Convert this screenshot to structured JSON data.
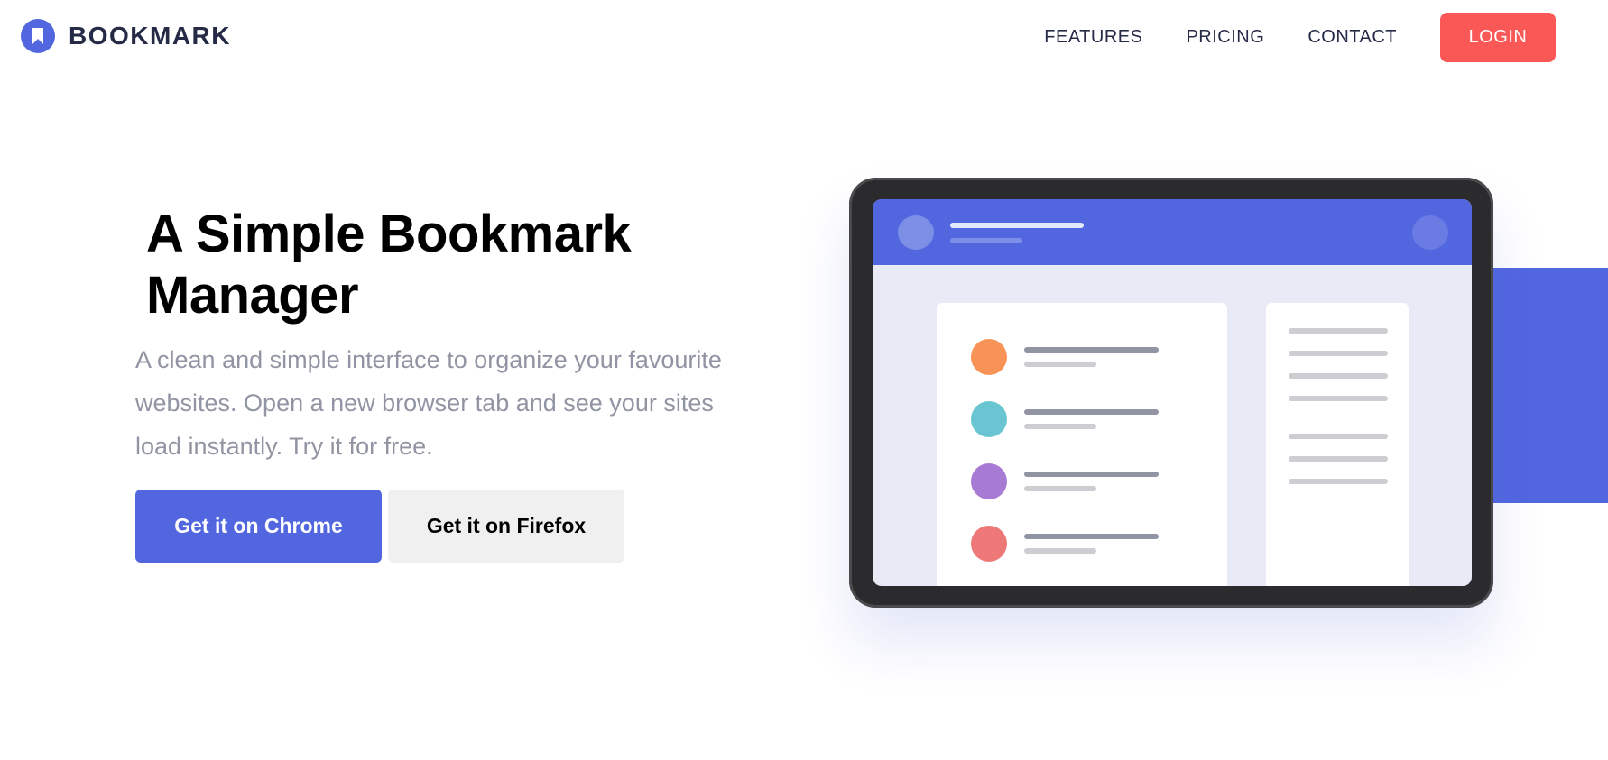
{
  "brand": {
    "name": "BOOKMARK",
    "icon": "bookmark-icon",
    "color": "#5267df"
  },
  "nav": {
    "links": [
      {
        "label": "FEATURES"
      },
      {
        "label": "PRICING"
      },
      {
        "label": "CONTACT"
      }
    ],
    "login_label": "LOGIN"
  },
  "hero": {
    "title": "A Simple Bookmark Manager",
    "description": "A clean and simple interface to organize your favourite websites. Open a new browser tab and see your sites load instantly. Try it for free.",
    "chrome_button": "Get it on Chrome",
    "firefox_button": "Get it on Firefox"
  },
  "colors": {
    "primary": "#5267df",
    "accent": "#fa5757",
    "dark": "#252b46",
    "muted": "#9194a2"
  },
  "illustration": {
    "list_item_colors": [
      "#f79357",
      "#6ac5d3",
      "#a77ad4",
      "#ee7878"
    ]
  }
}
